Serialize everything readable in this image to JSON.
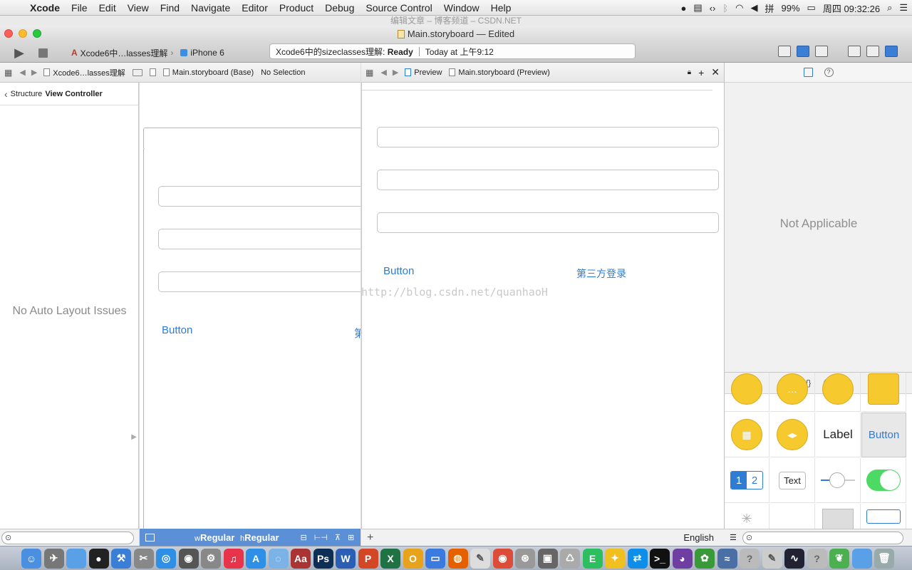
{
  "menubar": {
    "app": "Xcode",
    "items": [
      "File",
      "Edit",
      "View",
      "Find",
      "Navigate",
      "Editor",
      "Product",
      "Debug",
      "Source Control",
      "Window",
      "Help"
    ],
    "battery": "99%",
    "clock": "周四 09:32:26"
  },
  "background_window": {
    "title": "编辑文章 – 博客频道 – CSDN.NET"
  },
  "window": {
    "title": "Main.storyboard — Edited"
  },
  "toolbar": {
    "scheme": "Xcode6中…lasses理解",
    "device": "iPhone 6",
    "activity_project": "Xcode6中的sizeclasses理解:",
    "activity_status": "Ready",
    "activity_time": "Today at 上午9:12"
  },
  "jumpbar_left": [
    "Xcode6…lasses理解",
    "Main.storyboard (Base)",
    "No Selection"
  ],
  "jumpbar_right": [
    "Preview",
    "Main.storyboard (Preview)"
  ],
  "outline": {
    "back_label": "Structure",
    "current": "View Controller",
    "empty_message": "No Auto Layout Issues"
  },
  "canvas": {
    "button": "Button",
    "clipped_label": "第"
  },
  "preview": {
    "button": "Button",
    "third_party": "第三方登录",
    "watermark": "http://blog.csdn.net/quanhaoH"
  },
  "inspector": {
    "message": "Not Applicable"
  },
  "library": {
    "label_item": "Label",
    "button_item": "Button",
    "segment_1": "1",
    "segment_2": "2",
    "text_item": "Text"
  },
  "size_class": {
    "w_prefix": "w",
    "w_value": "Regular",
    "h_prefix": "h",
    "h_value": "Regular"
  },
  "preview_footer": {
    "language": "English"
  },
  "colors": {
    "link": "#2e7cd3",
    "size_bar": "#5b8fd6"
  }
}
